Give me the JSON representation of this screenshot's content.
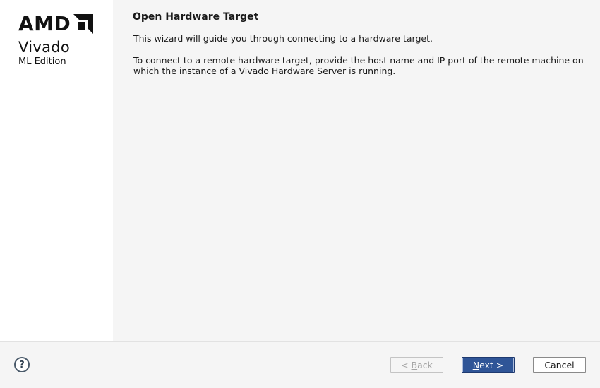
{
  "brand": {
    "company": "AMD",
    "product": "Vivado",
    "edition": "ML Edition"
  },
  "page": {
    "title": "Open Hardware Target",
    "intro": "This wizard will guide you through connecting to a hardware target.",
    "instructions": "To connect to a remote hardware target, provide the host name and IP port of the remote machine on which the instance of a Vivado Hardware Server is running."
  },
  "footer": {
    "help_label": "?",
    "back": {
      "prefix": "< ",
      "mnemonic": "B",
      "rest": "ack",
      "enabled": false
    },
    "next": {
      "mnemonic": "N",
      "rest": "ext >",
      "enabled": true
    },
    "cancel": {
      "label": "Cancel",
      "enabled": true
    }
  },
  "colors": {
    "primary_button": "#2f5597",
    "sidebar_bg": "#ffffff",
    "content_bg": "#f5f5f5"
  }
}
